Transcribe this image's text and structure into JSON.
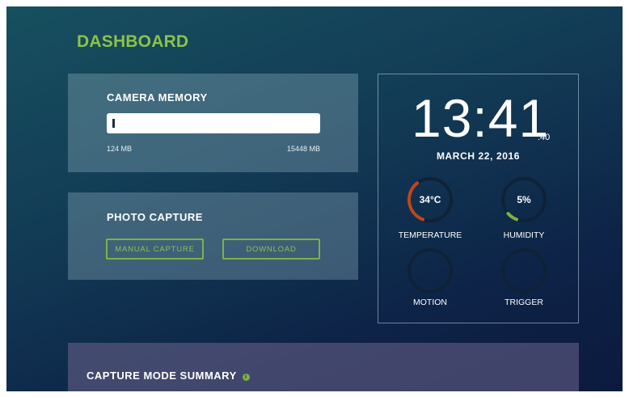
{
  "header": {
    "title": "DASHBOARD"
  },
  "camera_memory": {
    "title": "CAMERA MEMORY",
    "used_label": "124 MB",
    "total_label": "15448 MB",
    "used_fraction": 0.008
  },
  "photo_capture": {
    "title": "PHOTO CAPTURE",
    "manual_capture_label": "MANUAL CAPTURE",
    "download_label": "DOWNLOAD"
  },
  "clock": {
    "time": "13:41",
    "seconds": ":40",
    "date": "MARCH 22, 2016"
  },
  "sensors": {
    "temperature": {
      "value": "34°C",
      "label": "TEMPERATURE",
      "fraction": 0.34,
      "color": "#c0461b"
    },
    "humidity": {
      "value": "5%",
      "label": "HUMIDITY",
      "fraction": 0.05,
      "color": "#7cb342"
    },
    "motion": {
      "value": "",
      "label": "MOTION"
    },
    "trigger": {
      "value": "",
      "label": "TRIGGER"
    }
  },
  "summary": {
    "title": "CAPTURE MODE SUMMARY",
    "info_icon": "info-icon"
  },
  "colors": {
    "accent": "#8bc34a",
    "track": "#0f2236"
  }
}
